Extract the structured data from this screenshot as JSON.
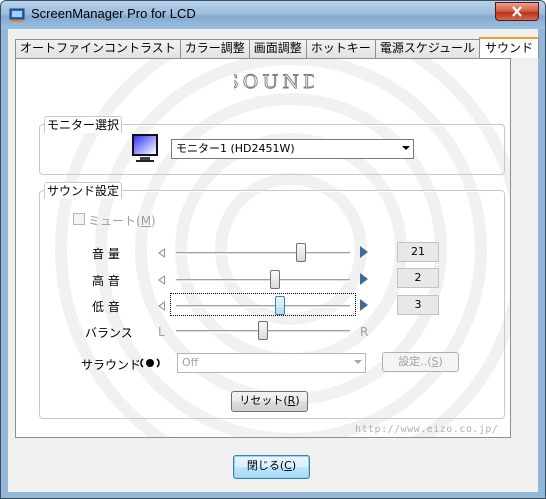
{
  "window": {
    "title": "ScreenManager Pro for LCD"
  },
  "tabs": [
    {
      "label": "オートファインコントラスト",
      "active": false
    },
    {
      "label": "カラー調整",
      "active": false
    },
    {
      "label": "画面調整",
      "active": false
    },
    {
      "label": "ホットキー",
      "active": false
    },
    {
      "label": "電源スケジュール",
      "active": false
    },
    {
      "label": "サウンド",
      "active": true
    }
  ],
  "logo_text": "SOUND",
  "monitor_group": {
    "title": "モニター選択",
    "selected_monitor": "モニター1 (HD2451W)"
  },
  "sound_group": {
    "title": "サウンド設定",
    "mute": {
      "label_text": "ミュート(",
      "mnemonic": "M",
      "label_end": ")",
      "checked": false,
      "enabled": false
    },
    "sliders": [
      {
        "label": "音 量",
        "value": "21",
        "fraction": 0.72,
        "focused": false
      },
      {
        "label": "高 音",
        "value": "2",
        "fraction": 0.57,
        "focused": false
      },
      {
        "label": "低 音",
        "value": "3",
        "fraction": 0.6,
        "focused": true
      }
    ],
    "balance": {
      "label": "バランス",
      "left": "L",
      "right": "R",
      "fraction": 0.5
    },
    "surround": {
      "label": "サラウンド",
      "value": "Off",
      "enabled": false
    },
    "settings_button": {
      "text": "設定..(",
      "mnemonic": "S",
      "end": ")"
    },
    "reset_button": {
      "text": "リセット(",
      "mnemonic": "R",
      "end": ")"
    }
  },
  "url_text": "http://www.eizo.co.jp/",
  "close_button": {
    "text": "閉じる(",
    "mnemonic": "C",
    "end": ")"
  },
  "colors": {
    "title_bar": "#9dbddd",
    "close_red": "#c8452c",
    "accent_arrow": "#3e6b98"
  }
}
